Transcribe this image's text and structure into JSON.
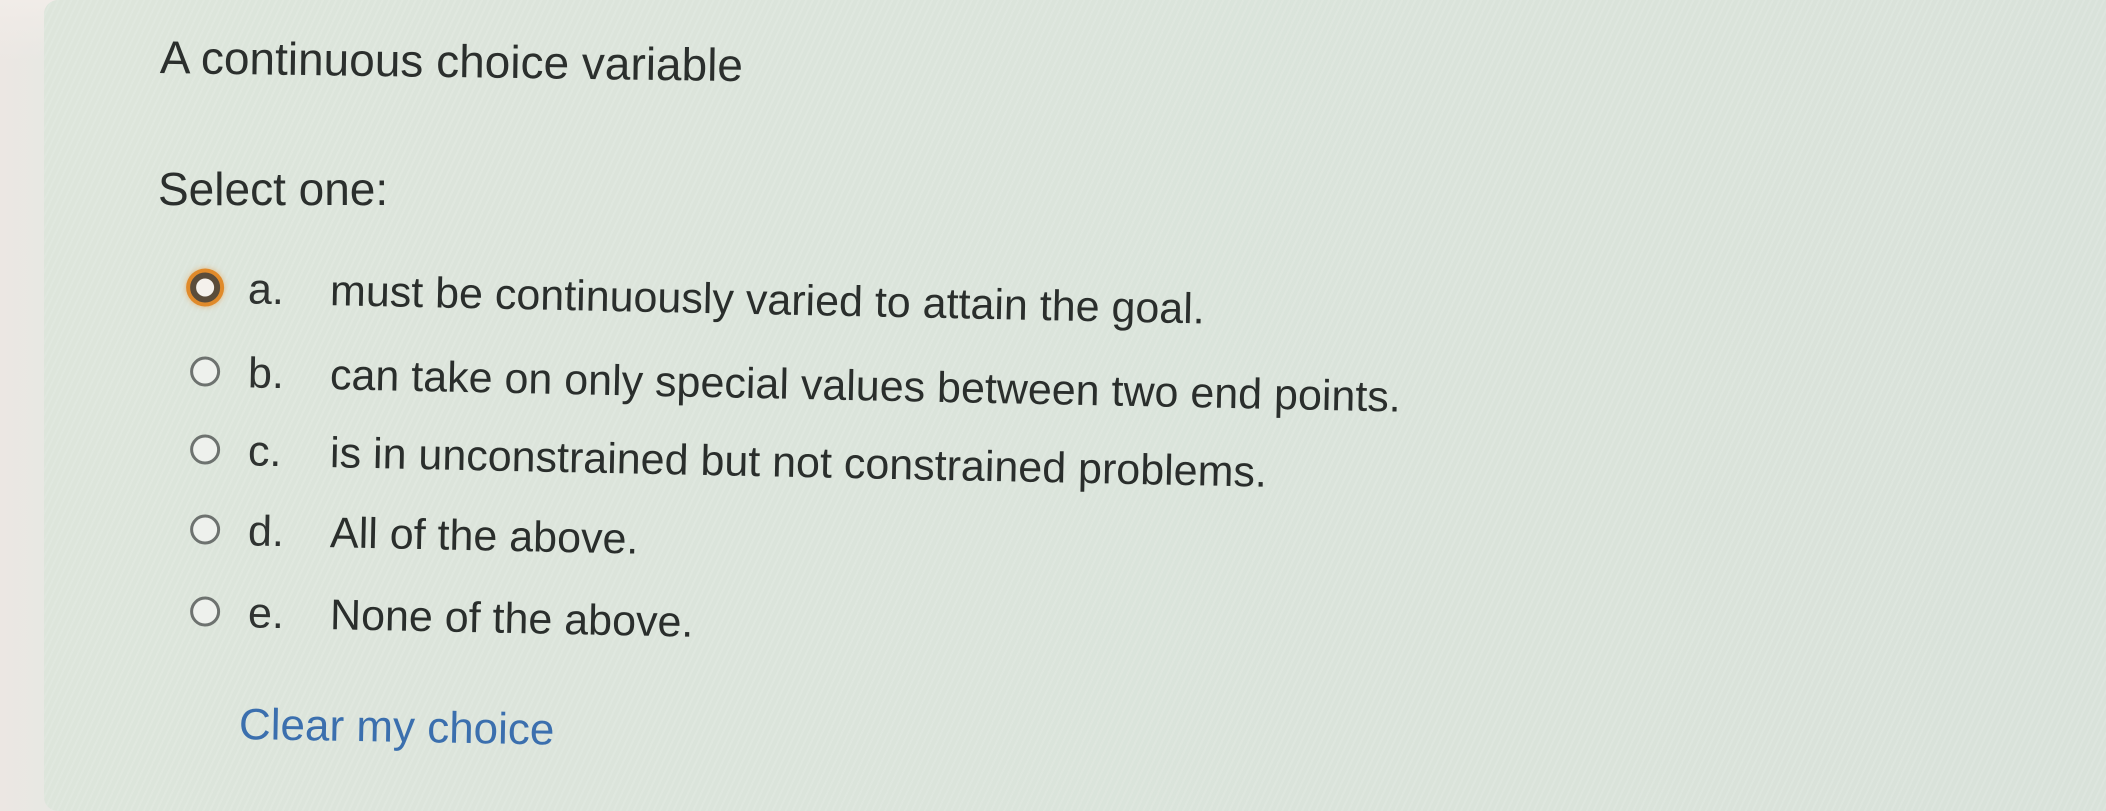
{
  "question": {
    "text": "A continuous choice variable",
    "prompt": "Select one:"
  },
  "options": [
    {
      "letter": "a.",
      "text": "must be continuously varied to attain the goal.",
      "focused": true
    },
    {
      "letter": "b.",
      "text": "can take on only special values between two end points.",
      "focused": false
    },
    {
      "letter": "c.",
      "text": "is in unconstrained but not constrained problems.",
      "focused": false
    },
    {
      "letter": "d.",
      "text": "All of the above.",
      "focused": false
    },
    {
      "letter": "e.",
      "text": "None of the above.",
      "focused": false
    }
  ],
  "clear_choice_label": "Clear my choice",
  "colors": {
    "link": "#3b6fae",
    "focus_ring": "#e08a2a",
    "text": "#2a2e2c"
  }
}
